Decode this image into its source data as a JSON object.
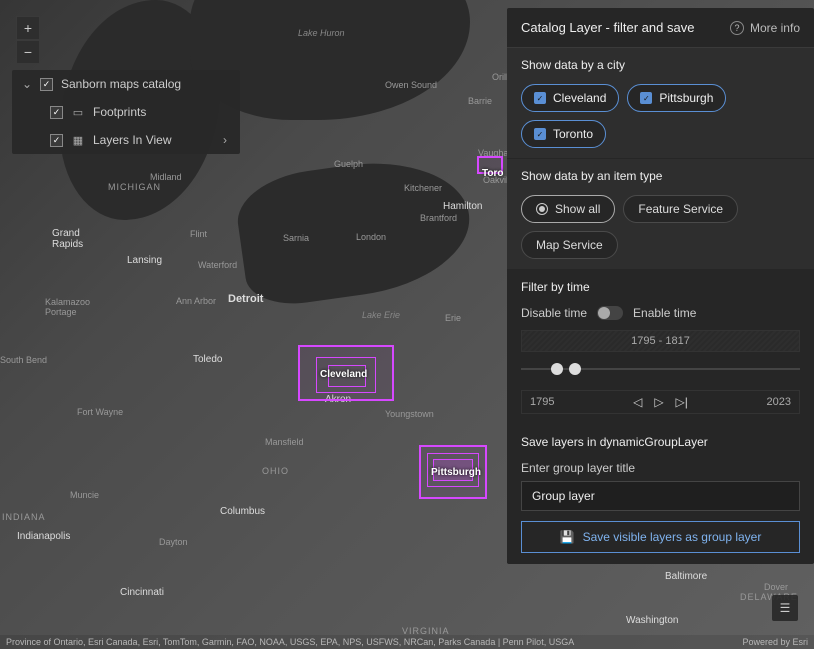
{
  "panel": {
    "title": "Catalog Layer - filter and save",
    "more_info": "More info"
  },
  "city_filter": {
    "title": "Show data by a city",
    "items": [
      "Cleveland",
      "Pittsburgh",
      "Toronto"
    ]
  },
  "type_filter": {
    "title": "Show data by an item type",
    "show_all": "Show all",
    "feature": "Feature Service",
    "map": "Map Service"
  },
  "time": {
    "title": "Filter by time",
    "disable": "Disable time",
    "enable": "Enable time",
    "range": "1795 - 1817",
    "start": "1795",
    "end": "2023"
  },
  "save": {
    "title": "Save layers in dynamicGroupLayer",
    "label": "Enter group layer title",
    "value": "Group layer",
    "button": "Save visible layers as group layer"
  },
  "layers": {
    "root": "Sanborn maps catalog",
    "footprints": "Footprints",
    "inview": "Layers In View"
  },
  "map_labels": {
    "lake_huron": "Lake Huron",
    "lake_erie": "Lake Erie",
    "michigan": "MICHIGAN",
    "ohio": "OHIO",
    "indiana": "INDIANA",
    "delaware": "DELAWARE",
    "virginia": "VIRGINIA",
    "midland": "Midland",
    "grand_rapids": "Grand Rapids",
    "flint": "Flint",
    "lansing": "Lansing",
    "kalamazoo": "Kalamazoo Portage",
    "ann_arbor": "Ann Arbor",
    "detroit": "Detroit",
    "toledo": "Toledo",
    "fort_wayne": "Fort Wayne",
    "south_bend": "South Bend",
    "muncie": "Muncie",
    "indianapolis": "Indianapolis",
    "columbus": "Columbus",
    "dayton": "Dayton",
    "cincinnati": "Cincinnati",
    "akron": "Akron",
    "youngstown": "Youngstown",
    "mansfield": "Mansfield",
    "erie": "Erie",
    "sarnia": "Sarnia",
    "waterford": "Waterford",
    "owen_sound": "Owen Sound",
    "barrie": "Barrie",
    "orillia": "Orillia",
    "vaughan": "Vaugha",
    "toronto": "Toro",
    "oakville": "Oakville",
    "kitchener": "Kitchener",
    "brantford": "Brantford",
    "hamilton": "Hamilton",
    "london": "London",
    "guelph": "Guelph",
    "baltimore": "Baltimore",
    "washington": "Washington",
    "dover": "Dover",
    "cleveland_fp": "Cleveland",
    "pittsburgh_fp": "Pittsburgh"
  },
  "attribution_left": "Province of Ontario, Esri Canada, Esri, TomTom, Garmin, FAO, NOAA, USGS, EPA, NPS, USFWS, NRCan, Parks Canada | Penn Pilot, USGA",
  "attribution_right": "Powered by Esri"
}
